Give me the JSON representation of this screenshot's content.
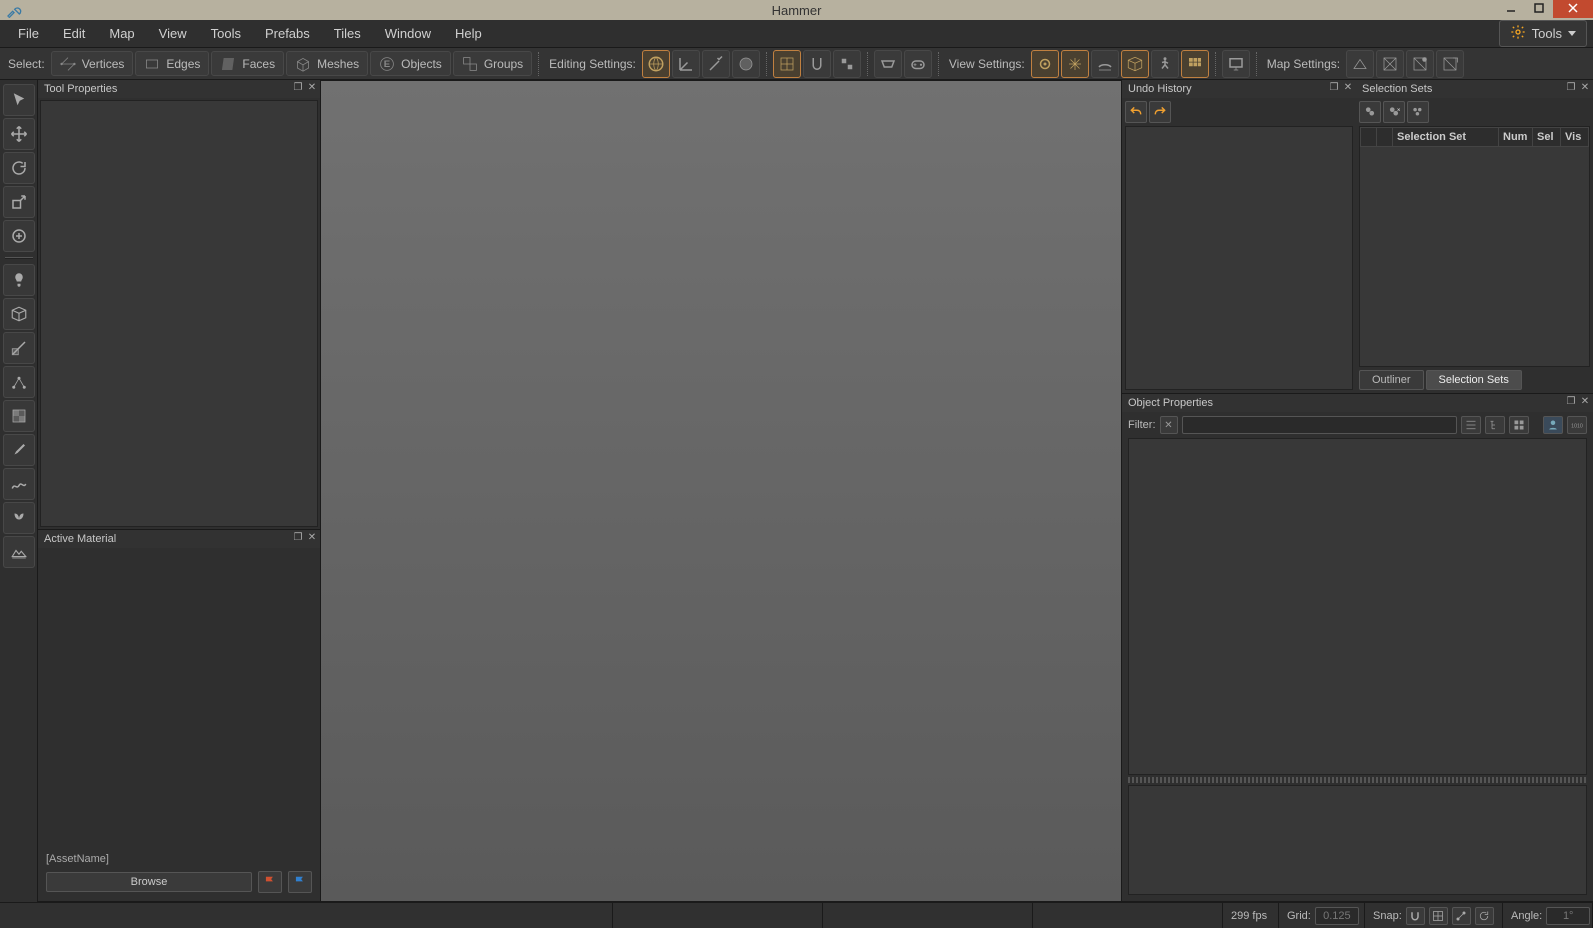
{
  "title": "Hammer",
  "menu": [
    "File",
    "Edit",
    "Map",
    "View",
    "Tools",
    "Prefabs",
    "Tiles",
    "Window",
    "Help"
  ],
  "tools_button": "Tools",
  "toolbar": {
    "select_label": "Select:",
    "select_modes": [
      "Vertices",
      "Edges",
      "Faces",
      "Meshes",
      "Objects",
      "Groups"
    ],
    "editing_label": "Editing Settings:",
    "view_label": "View Settings:",
    "map_label": "Map Settings:"
  },
  "panels": {
    "tool_properties": "Tool Properties",
    "active_material": "Active Material",
    "asset_name": "[AssetName]",
    "browse": "Browse",
    "undo_history": "Undo History",
    "selection_sets_title": "Selection Sets",
    "object_properties": "Object Properties",
    "filter_label": "Filter:",
    "filter_placeholder": ""
  },
  "selection_sets": {
    "columns": [
      "",
      "",
      "Selection Set",
      "Num",
      "Sel",
      "Vis"
    ],
    "tabs": [
      "Outliner",
      "Selection Sets"
    ],
    "active_tab": 1
  },
  "statusbar": {
    "fps": "299 fps",
    "grid_label": "Grid:",
    "grid_value": "0.125",
    "snap_label": "Snap:",
    "angle_label": "Angle:",
    "angle_value": "1°"
  }
}
